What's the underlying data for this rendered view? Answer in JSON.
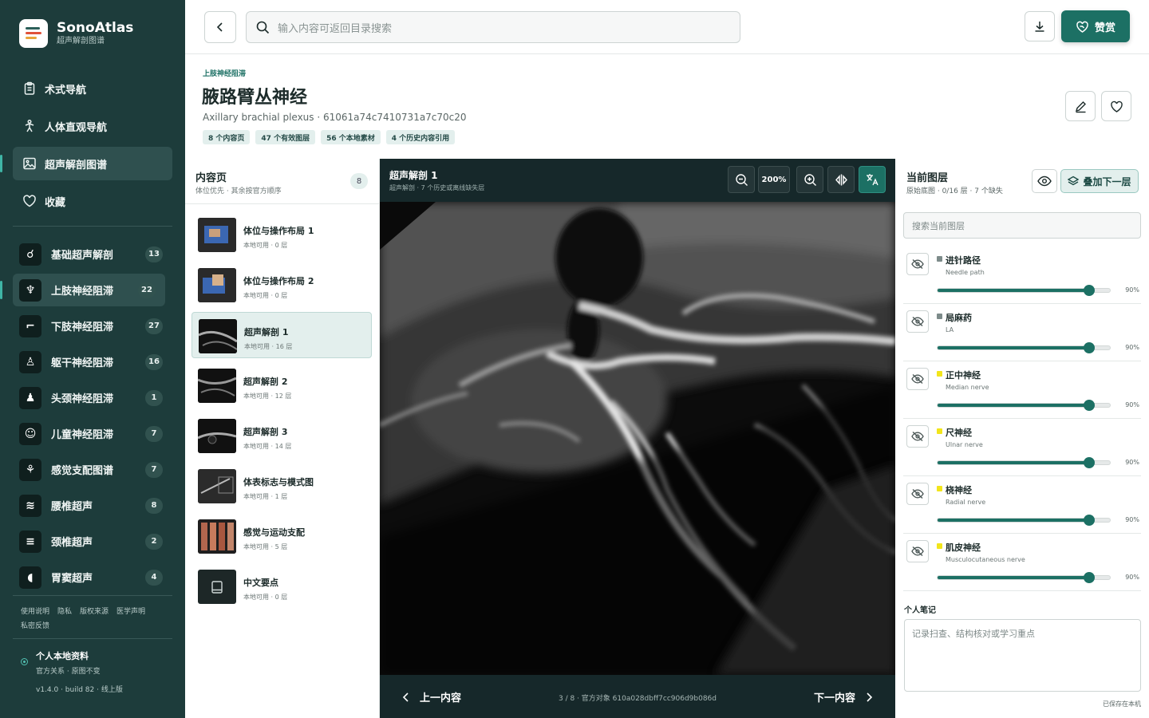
{
  "brand": {
    "name": "SonoAtlas",
    "subtitle": "超声解剖图谱"
  },
  "nav": [
    {
      "label": "术式导航",
      "icon": "clipboard-icon"
    },
    {
      "label": "人体直观导航",
      "icon": "person-icon"
    },
    {
      "label": "超声解剖图谱",
      "icon": "image-icon",
      "active": true
    },
    {
      "label": "收藏",
      "icon": "heart-icon"
    }
  ],
  "categories": [
    {
      "label": "基础超声解剖",
      "count": "13"
    },
    {
      "label": "上肢神经阻滞",
      "count": "22",
      "active": true
    },
    {
      "label": "下肢神经阻滞",
      "count": "27"
    },
    {
      "label": "躯干神经阻滞",
      "count": "16"
    },
    {
      "label": "头颈神经阻滞",
      "count": "1"
    },
    {
      "label": "儿童神经阻滞",
      "count": "7"
    },
    {
      "label": "感觉支配图谱",
      "count": "7"
    },
    {
      "label": "腰椎超声",
      "count": "8"
    },
    {
      "label": "颈椎超声",
      "count": "2"
    },
    {
      "label": "胃窦超声",
      "count": "4"
    }
  ],
  "footer_links": [
    "使用说明",
    "隐私",
    "版权来源",
    "医学声明",
    "私密反馈"
  ],
  "profile": {
    "name": "个人本地资料",
    "sub": "官方关系 · 原图不变",
    "version": "v1.4.0 · build 82 · 线上版"
  },
  "search": {
    "placeholder": "输入内容可返回目录搜索"
  },
  "donate_label": "赞赏",
  "header": {
    "crumb": "上肢神经阻滞",
    "title": "腋路臂丛神经",
    "subtitle": "Axillary brachial plexus · 61061a74c7410731a7c70c20",
    "tags": [
      "8 个内容页",
      "47 个有效图层",
      "56 个本地素材",
      "4 个历史内容引用"
    ]
  },
  "content_list": {
    "title": "内容页",
    "subtitle": "体位优先 · 其余按官方顺序",
    "count": "8",
    "items": [
      {
        "title": "体位与操作布局 1",
        "sub": "本地可用 · 0 层"
      },
      {
        "title": "体位与操作布局 2",
        "sub": "本地可用 · 0 层"
      },
      {
        "title": "超声解剖 1",
        "sub": "本地可用 · 16 层",
        "active": true
      },
      {
        "title": "超声解剖 2",
        "sub": "本地可用 · 12 层"
      },
      {
        "title": "超声解剖 3",
        "sub": "本地可用 · 14 层"
      },
      {
        "title": "体表标志与模式图",
        "sub": "本地可用 · 1 层"
      },
      {
        "title": "感觉与运动支配",
        "sub": "本地可用 · 5 层"
      },
      {
        "title": "中文要点",
        "sub": "本地可用 · 0 层"
      }
    ]
  },
  "viewer": {
    "title": "超声解剖 1",
    "subtitle": "超声解剖 · 7 个历史或离线缺失层",
    "zoom": "200%",
    "prev_label": "上一内容",
    "next_label": "下一内容",
    "status": "3 / 8 · 官方对象 610a028dbff7cc906d9b086d"
  },
  "layers_panel": {
    "title": "当前图层",
    "subtitle": "原始底图 · 0/16 层 · 7 个缺失",
    "add_label": "叠加下一层",
    "search_placeholder": "搜索当前图层",
    "layers": [
      {
        "name": "进针路径",
        "en": "Needle path",
        "color": "#7d8b8a",
        "opacity": 0.9,
        "pct": "90%"
      },
      {
        "name": "局麻药",
        "en": "LA",
        "color": "#7d8b8a",
        "opacity": 0.9,
        "pct": "90%"
      },
      {
        "name": "正中神经",
        "en": "Median nerve",
        "color": "#f2e51b",
        "opacity": 0.9,
        "pct": "90%"
      },
      {
        "name": "尺神经",
        "en": "Ulnar nerve",
        "color": "#f2e51b",
        "opacity": 0.9,
        "pct": "90%"
      },
      {
        "name": "桡神经",
        "en": "Radial nerve",
        "color": "#f2e51b",
        "opacity": 0.9,
        "pct": "90%"
      },
      {
        "name": "肌皮神经",
        "en": "Musculocutaneous nerve",
        "color": "#f2e51b",
        "opacity": 0.9,
        "pct": "90%"
      }
    ],
    "notes_label": "个人笔记",
    "notes_placeholder": "记录扫查、结构核对或学习重点",
    "saved_label": "已保存在本机"
  }
}
